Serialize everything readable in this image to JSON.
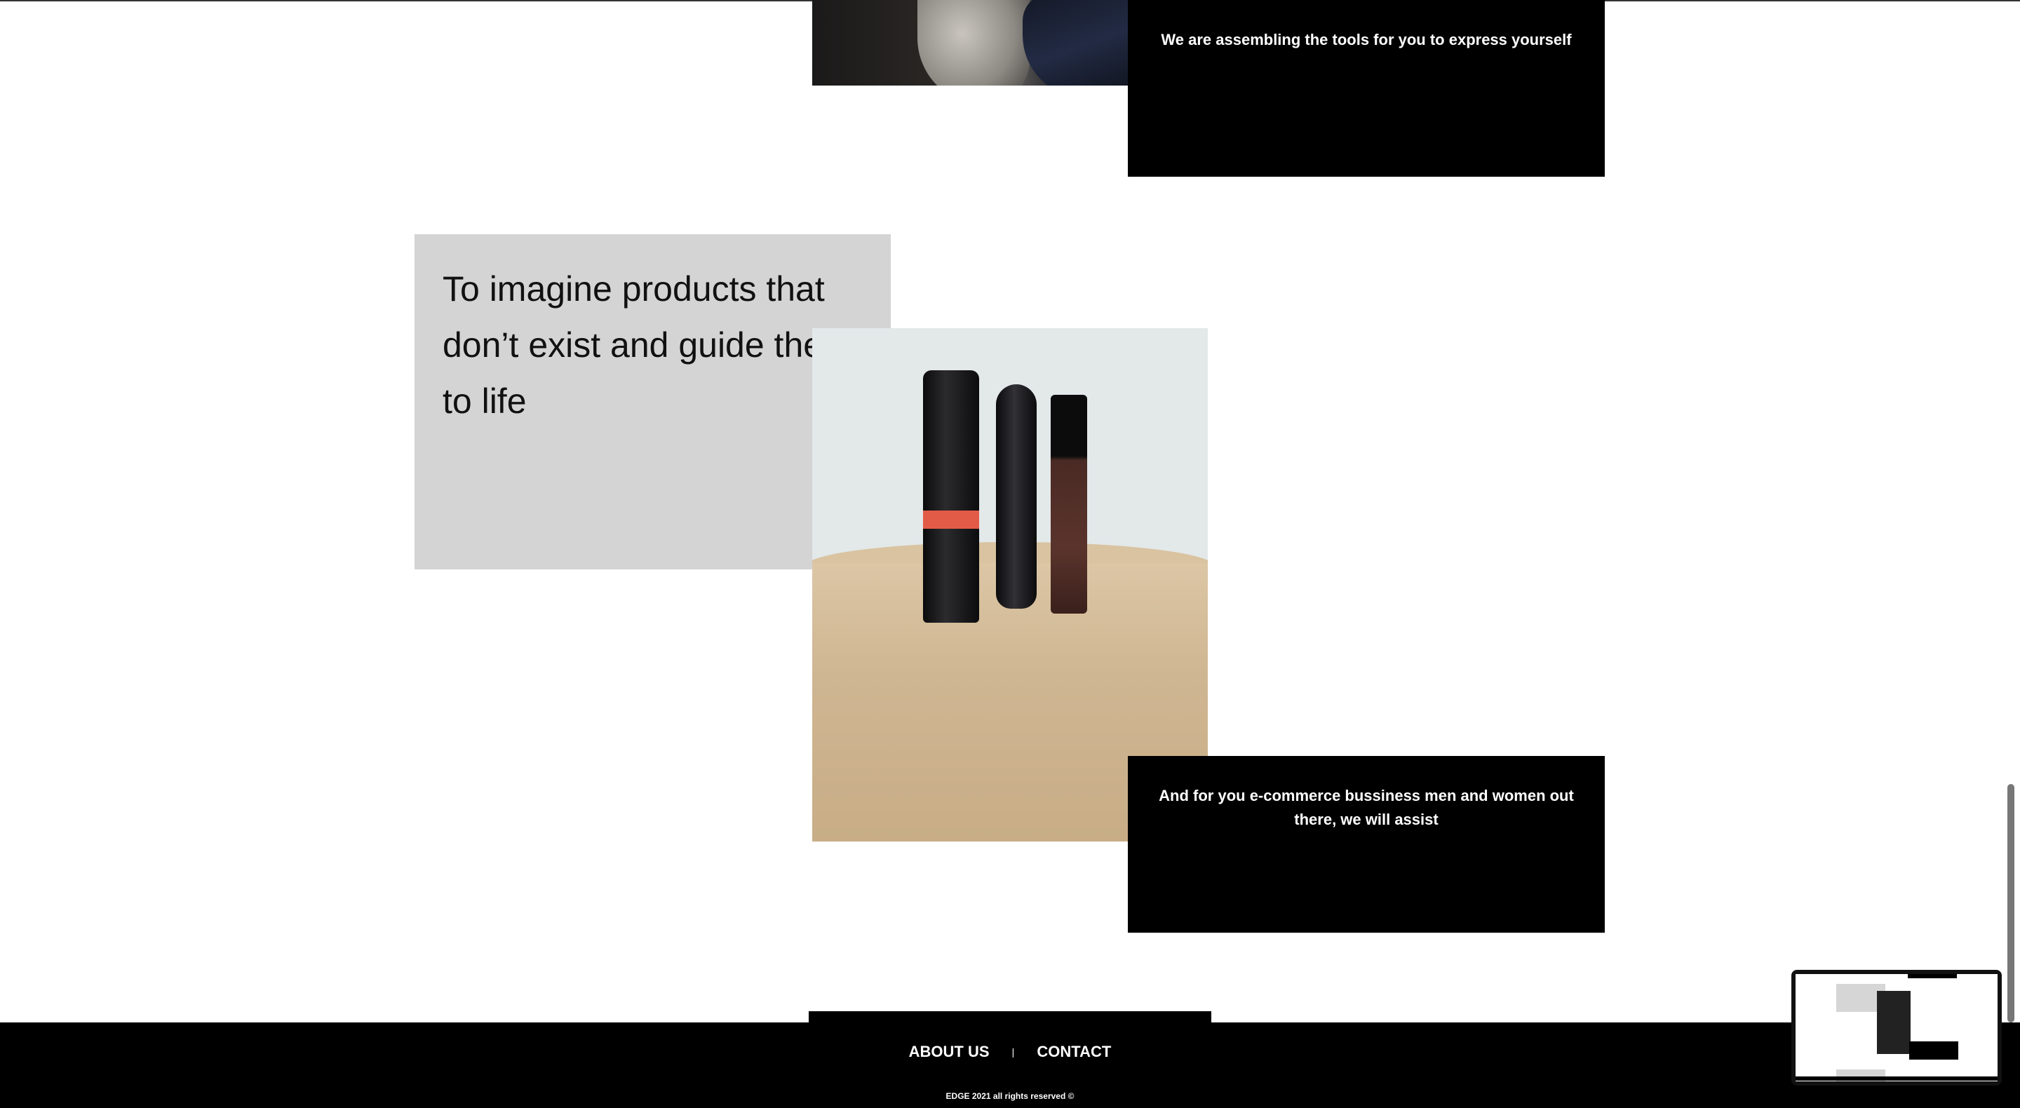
{
  "sections": {
    "box_top_text": "We are assembling the tools for you to express yourself",
    "headline": "To imagine products that don’t exist and guide them to life",
    "box_bottom_text": "And for you e-commerce bussiness men and women out there, we will assist"
  },
  "footer": {
    "nav": [
      {
        "label": "ABOUT US"
      },
      {
        "label": "CONTACT"
      }
    ],
    "separator": "|",
    "copyright": "EDGE 2021 all rights reserved ©"
  }
}
